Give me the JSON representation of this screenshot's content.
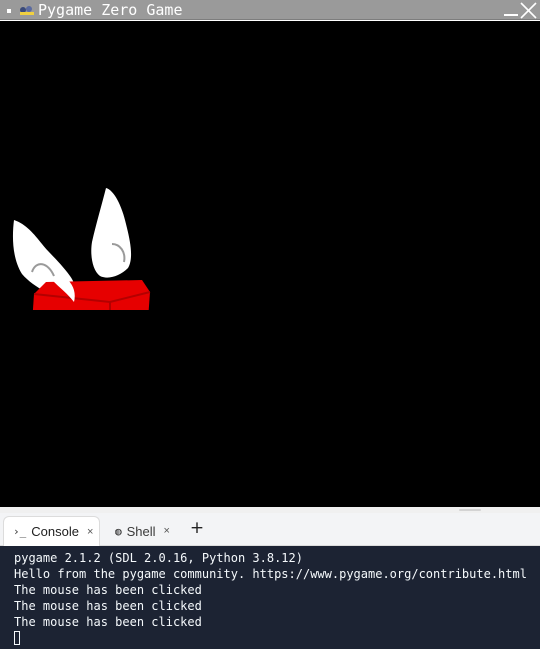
{
  "window": {
    "title": "Pygame Zero Game",
    "titlebar_color": "#9a9a9a",
    "icons": [
      "window-menu-icon",
      "pygame-app-icon",
      "minimize-icon",
      "close-icon"
    ]
  },
  "game": {
    "background": "#000000",
    "sprite": "red-brick-with-white-wings",
    "sprite_colors": {
      "brick": "#e60000",
      "wings": "#ffffff"
    }
  },
  "panel": {
    "tabs": [
      {
        "label": "Console",
        "icon": "console-prompt-icon",
        "icon_glyph": "›_",
        "close_glyph": "×",
        "active": true
      },
      {
        "label": "Shell",
        "icon": "shell-icon",
        "icon_glyph": "◍",
        "close_glyph": "×",
        "active": false
      }
    ],
    "add_tab_glyph": "+"
  },
  "console": {
    "background": "#1c2333",
    "lines": [
      "pygame 2.1.2 (SDL 2.0.16, Python 3.8.12)",
      "Hello from the pygame community. https://www.pygame.org/contribute.html",
      "The mouse has been clicked",
      "The mouse has been clicked",
      "The mouse has been clicked"
    ]
  }
}
